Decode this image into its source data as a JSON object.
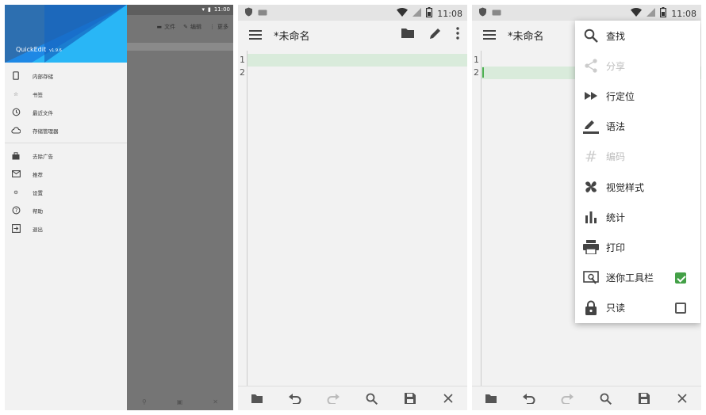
{
  "panel1": {
    "status_time": "11:00",
    "toolbar": [
      {
        "icon": "folder-icon",
        "label": "文件"
      },
      {
        "icon": "pencil-icon",
        "label": "编辑"
      },
      {
        "icon": "more-icon",
        "label": "更多"
      }
    ],
    "drawer": {
      "app_name": "QuickEdit",
      "version": "v1.9.6",
      "items_top": [
        {
          "icon": "phone-icon",
          "label": "内部存储"
        },
        {
          "icon": "star-icon",
          "label": "书签"
        },
        {
          "icon": "history-icon",
          "label": "最近文件"
        },
        {
          "icon": "cloud-icon",
          "label": "存储管理器"
        }
      ],
      "items_bottom": [
        {
          "icon": "bag-icon",
          "label": "去除广告"
        },
        {
          "icon": "mail-icon",
          "label": "推荐"
        },
        {
          "icon": "gear-icon",
          "label": "设置"
        },
        {
          "icon": "help-icon",
          "label": "帮助"
        },
        {
          "icon": "exit-icon",
          "label": "退出"
        }
      ]
    }
  },
  "panel2": {
    "status_time": "11:08",
    "title": "*未命名",
    "line_numbers": [
      "1",
      "2"
    ]
  },
  "panel3": {
    "status_time": "11:08",
    "title": "*未命名",
    "line_numbers": [
      "1",
      "2"
    ],
    "menu": [
      {
        "icon": "search-icon",
        "label": "查找",
        "enabled": true
      },
      {
        "icon": "share-icon",
        "label": "分享",
        "enabled": false
      },
      {
        "icon": "goto-line-icon",
        "label": "行定位",
        "enabled": true
      },
      {
        "icon": "syntax-icon",
        "label": "语法",
        "enabled": true
      },
      {
        "icon": "encoding-icon",
        "label": "编码",
        "enabled": false
      },
      {
        "icon": "style-icon",
        "label": "视觉样式",
        "enabled": true
      },
      {
        "icon": "stats-icon",
        "label": "统计",
        "enabled": true
      },
      {
        "icon": "print-icon",
        "label": "打印",
        "enabled": true
      },
      {
        "icon": "mini-toolbar-icon",
        "label": "迷你工具栏",
        "enabled": true,
        "checked": true
      },
      {
        "icon": "lock-icon",
        "label": "只读",
        "enabled": true,
        "checked": false
      }
    ]
  },
  "colors": {
    "accent": "#43a047",
    "drawer_header": "#1e88e5",
    "line_highlight": "#d9ebdb"
  }
}
